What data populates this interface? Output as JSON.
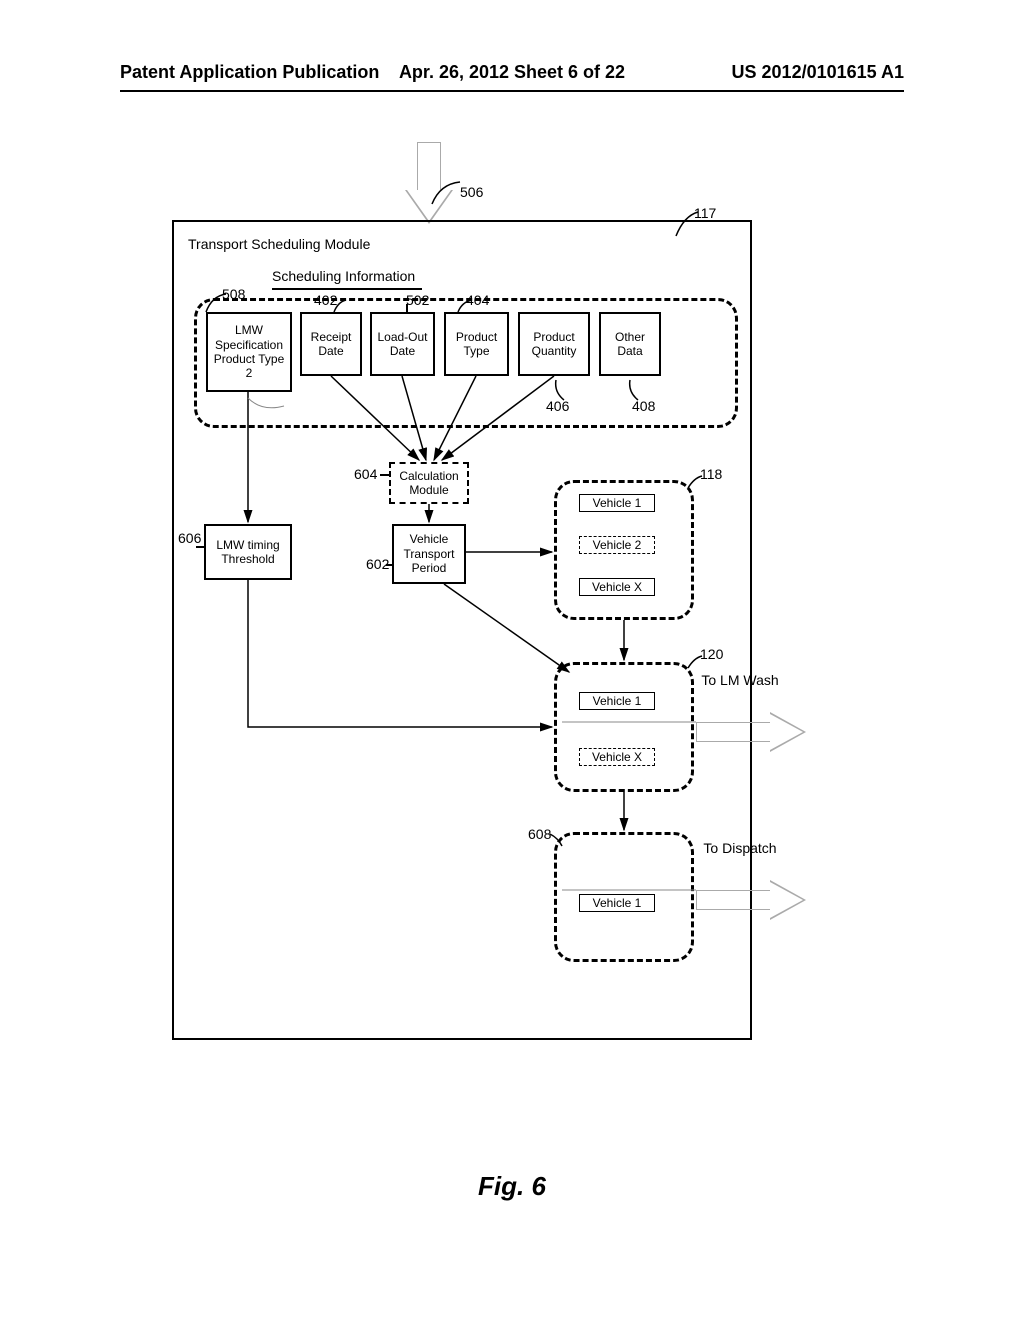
{
  "header": {
    "left": "Patent Application Publication",
    "center": "Apr. 26, 2012  Sheet 6 of 22",
    "right": "US 2012/0101615 A1"
  },
  "module_title": "Transport Scheduling Module",
  "scheduling_title": "Scheduling Information",
  "info_boxes": {
    "b1": "LMW Specification Product Type 2",
    "b2": "Receipt Date",
    "b3": "Load-Out Date",
    "b4": "Product Type",
    "b5": "Product Quantity",
    "b6": "Other Data"
  },
  "calc": "Calculation Module",
  "lmw_thresh": "LMW timing Threshold",
  "vtp": "Vehicle Transport Period",
  "vehicles": {
    "g118": {
      "v1": "Vehicle 1",
      "v2": "Vehicle 2",
      "vx": "Vehicle X"
    },
    "g120": {
      "v1": "Vehicle 1",
      "vx": "Vehicle X"
    },
    "g608": {
      "v1": "Vehicle 1"
    }
  },
  "out_labels": {
    "lmwash": "To LM Wash",
    "dispatch": "To Dispatch"
  },
  "refs": {
    "r506": "506",
    "r117": "117",
    "r508": "508",
    "r402": "402",
    "r502": "502",
    "r404": "404",
    "r406": "406",
    "r408": "408",
    "r604": "604",
    "r606": "606",
    "r602": "602",
    "r118": "118",
    "r120": "120",
    "r608": "608"
  },
  "figure_caption": "Fig. 6"
}
